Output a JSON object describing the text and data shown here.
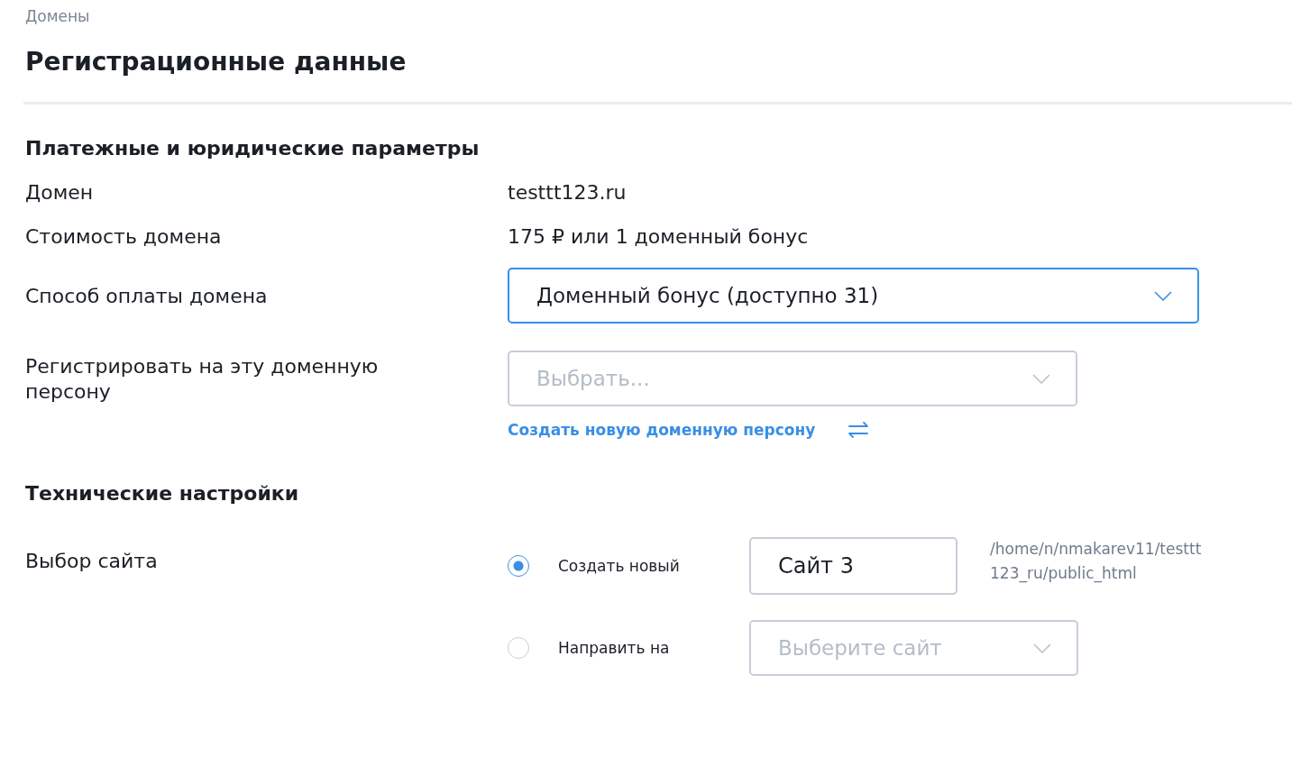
{
  "breadcrumb": "Домены",
  "title": "Регистрационные данные",
  "payment_section": {
    "heading": "Платежные и юридические параметры",
    "domain": {
      "label": "Домен",
      "value": "testtt123.ru"
    },
    "price": {
      "label": "Стоимость домена",
      "value": "175 ₽ или 1 доменный бонус"
    },
    "payment_method": {
      "label": "Способ оплаты домена",
      "value": "Доменный бонус (доступно 31)",
      "focused": true
    },
    "person": {
      "label": "Регистрировать на эту доменную персону",
      "placeholder": "Выбрать...",
      "focused": false,
      "link": "Создать новую доменную персону"
    }
  },
  "tech_section": {
    "heading": "Технические настройки",
    "label": "Выбор сайта",
    "options": [
      {
        "kind": "input",
        "label": "Создать новый",
        "selected": true,
        "value": "Сайт 3",
        "path": "/home/n/nmakarev11/testtt123_ru/public_html"
      },
      {
        "kind": "select",
        "label": "Направить на",
        "selected": false,
        "placeholder": "Выберите сайт"
      }
    ]
  }
}
